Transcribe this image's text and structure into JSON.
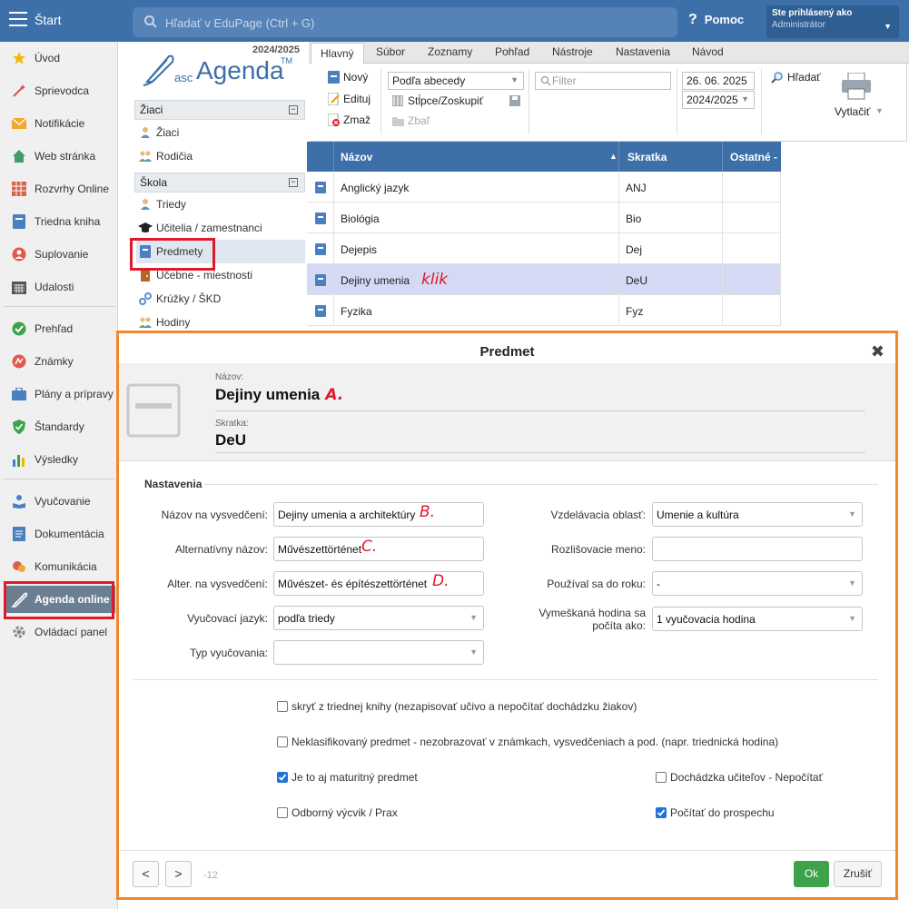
{
  "topbar": {
    "start_label": "Štart",
    "search_placeholder": "Hľadať v EduPage (Ctrl + G)",
    "help_label": "Pomoc",
    "user_line1": "Ste prihlásený ako",
    "user_line2": "Administrátor"
  },
  "sidebar": {
    "items": [
      {
        "label": "Úvod",
        "icon": "star-icon"
      },
      {
        "label": "Sprievodca",
        "icon": "wand-icon"
      },
      {
        "label": "Notifikácie",
        "icon": "envelope-icon"
      },
      {
        "label": "Web stránka",
        "icon": "home-icon"
      },
      {
        "label": "Rozvrhy Online",
        "icon": "grid-icon"
      },
      {
        "label": "Triedna kniha",
        "icon": "book-icon"
      },
      {
        "label": "Suplovanie",
        "icon": "person-icon"
      },
      {
        "label": "Udalosti",
        "icon": "calendar-icon"
      },
      {
        "label": "Prehľad",
        "icon": "check-circle-icon"
      },
      {
        "label": "Známky",
        "icon": "grade-icon"
      },
      {
        "label": "Plány a prípravy",
        "icon": "briefcase-icon"
      },
      {
        "label": "Štandardy",
        "icon": "shield-icon"
      },
      {
        "label": "Výsledky",
        "icon": "bar-chart-icon"
      },
      {
        "label": "Vyučovanie",
        "icon": "reader-icon"
      },
      {
        "label": "Dokumentácia",
        "icon": "document-icon"
      },
      {
        "label": "Komunikácia",
        "icon": "chat-icon"
      },
      {
        "label": "Agenda online",
        "icon": "feather-icon"
      },
      {
        "label": "Ovládací panel",
        "icon": "gear-icon"
      }
    ]
  },
  "midnav": {
    "year": "2024/2025",
    "logo_prefix": "asc",
    "logo_brand": "Agenda",
    "logo_tm": "TM",
    "section_ziaci": "Žiaci",
    "section_skola": "Škola",
    "ziaci_items": [
      "Žiaci",
      "Rodičia"
    ],
    "skola_items": [
      "Triedy",
      "Učitelia / zamestnanci",
      "Predmety",
      "Učebne - miestnosti",
      "Krúžky / ŠKD",
      "Hodiny"
    ]
  },
  "tabs": [
    "Hlavný",
    "Súbor",
    "Zoznamy",
    "Pohľad",
    "Nástroje",
    "Nastavenia",
    "Návod"
  ],
  "ribbon": {
    "new": "Nový",
    "edit": "Edituj",
    "delete": "Zmaž",
    "sort_select": "Podľa abecedy",
    "columns": "Stĺpce/Zoskupiť",
    "collapse": "Zbaľ",
    "filter_placeholder": "Filter",
    "date": "26. 06. 2025",
    "year_select": "2024/2025",
    "search": "Hľadať",
    "print": "Vytlačiť"
  },
  "table": {
    "headers": [
      "Názov",
      "Skratka",
      "Ostatné -"
    ],
    "rows": [
      {
        "name": "Anglický jazyk",
        "abbr": "ANJ"
      },
      {
        "name": "Biológia",
        "abbr": "Bio"
      },
      {
        "name": "Dejepis",
        "abbr": "Dej"
      },
      {
        "name": "Dejiny umenia",
        "abbr": "DeU"
      },
      {
        "name": "Fyzika",
        "abbr": "Fyz"
      }
    ],
    "note_klik": "klik"
  },
  "modal": {
    "title": "Predmet",
    "name_label": "Názov:",
    "name_value": "Dejiny umenia",
    "name_note": "A.",
    "abbr_label": "Skratka:",
    "abbr_value": "DeU",
    "section": "Nastavenia",
    "fields_left": [
      {
        "label": "Názov na vysvedčení:",
        "value": "Dejiny umenia a architektúry",
        "note": "B."
      },
      {
        "label": "Alternatívny názov:",
        "value": "Művészettörténet",
        "note": "C."
      },
      {
        "label": "Alter. na vysvedčení:",
        "value": "Művészet- és építészettörténet",
        "note": "D."
      },
      {
        "label": "Vyučovací jazyk:",
        "value": "podľa triedy"
      },
      {
        "label": "Typ vyučovania:",
        "value": ""
      }
    ],
    "fields_right": [
      {
        "label": "Vzdelávacia oblasť:",
        "value": "Umenie a kultúra"
      },
      {
        "label": "Rozlišovacie meno:",
        "value": ""
      },
      {
        "label": "Používal sa do roku:",
        "value": "-"
      },
      {
        "label_line1": "Vymeškaná hodina sa",
        "label_line2": "počíta ako:",
        "value": "1 vyučovacia hodina"
      }
    ],
    "checks": {
      "hide_from_classbook": {
        "label": "skryť z triednej knihy (nezapisovať učivo a nepočítať dochádzku žiakov)",
        "checked": false
      },
      "unclassified": {
        "label": "Neklasifikovaný predmet - nezobrazovať v známkach, vysvedčeniach a pod. (napr. triednická hodina)",
        "checked": false
      },
      "maturity": {
        "label": "Je to aj maturitný predmet",
        "checked": true
      },
      "teacher_attendance": {
        "label": "Dochádzka učiteľov - Nepočítať",
        "checked": false
      },
      "vocational": {
        "label": "Odborný výcvik / Prax",
        "checked": false
      },
      "count_to_average": {
        "label": "Počítať do prospechu",
        "checked": true
      }
    },
    "counter": "-12",
    "prev": "<",
    "next": ">",
    "ok": "Ok",
    "cancel": "Zrušiť"
  },
  "colors": {
    "brand_blue": "#3d6fa8",
    "highlight_red": "#e0192a",
    "modal_border": "#f4862e",
    "ok_green": "#3ea24a"
  }
}
